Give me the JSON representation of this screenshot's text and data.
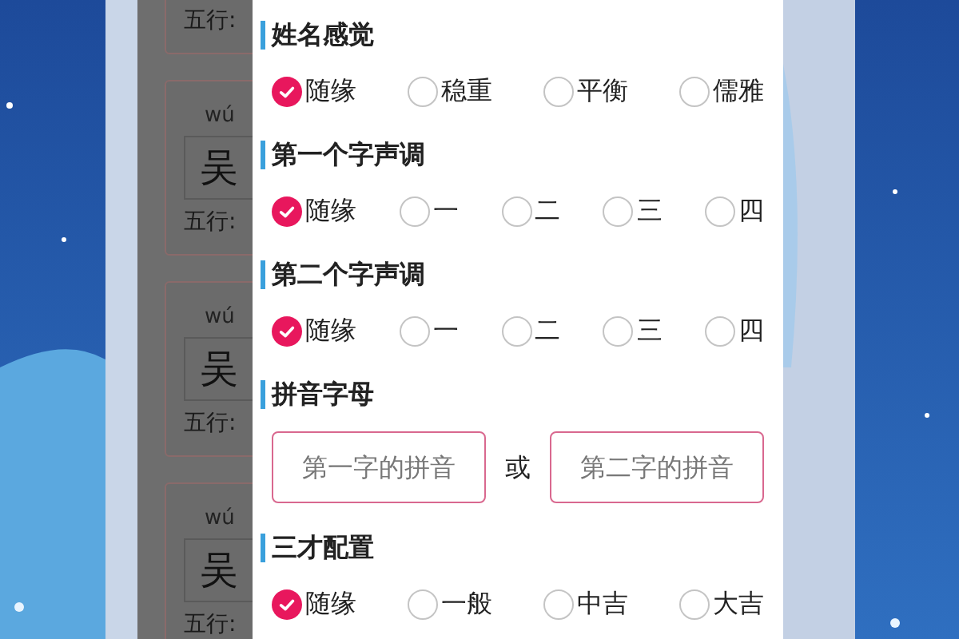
{
  "background_cards": [
    {
      "wuxing_label": "五行:"
    },
    {
      "pinyin": "wú",
      "character": "吴",
      "wuxing_label": "五行:"
    },
    {
      "pinyin": "wú",
      "character": "吴",
      "wuxing_label": "五行:"
    },
    {
      "pinyin": "wú",
      "character": "吴",
      "wuxing_label": "五行:"
    }
  ],
  "panel": {
    "sections": [
      {
        "kind": "radio",
        "title": "姓名感觉",
        "options": [
          {
            "label": "随缘",
            "selected": true
          },
          {
            "label": "稳重",
            "selected": false
          },
          {
            "label": "平衡",
            "selected": false
          },
          {
            "label": "儒雅",
            "selected": false
          }
        ]
      },
      {
        "kind": "radio",
        "title": "第一个字声调",
        "options": [
          {
            "label": "随缘",
            "selected": true
          },
          {
            "label": "一",
            "selected": false
          },
          {
            "label": "二",
            "selected": false
          },
          {
            "label": "三",
            "selected": false
          },
          {
            "label": "四",
            "selected": false
          }
        ]
      },
      {
        "kind": "radio",
        "title": "第二个字声调",
        "options": [
          {
            "label": "随缘",
            "selected": true
          },
          {
            "label": "一",
            "selected": false
          },
          {
            "label": "二",
            "selected": false
          },
          {
            "label": "三",
            "selected": false
          },
          {
            "label": "四",
            "selected": false
          }
        ]
      },
      {
        "kind": "inputs",
        "title": "拼音字母",
        "first": {
          "placeholder": "第一字的拼音"
        },
        "separator": "或",
        "second": {
          "placeholder": "第二字的拼音"
        }
      },
      {
        "kind": "radio",
        "title": "三才配置",
        "options": [
          {
            "label": "随缘",
            "selected": true
          },
          {
            "label": "一般",
            "selected": false
          },
          {
            "label": "中吉",
            "selected": false
          },
          {
            "label": "大吉",
            "selected": false
          }
        ]
      }
    ]
  }
}
